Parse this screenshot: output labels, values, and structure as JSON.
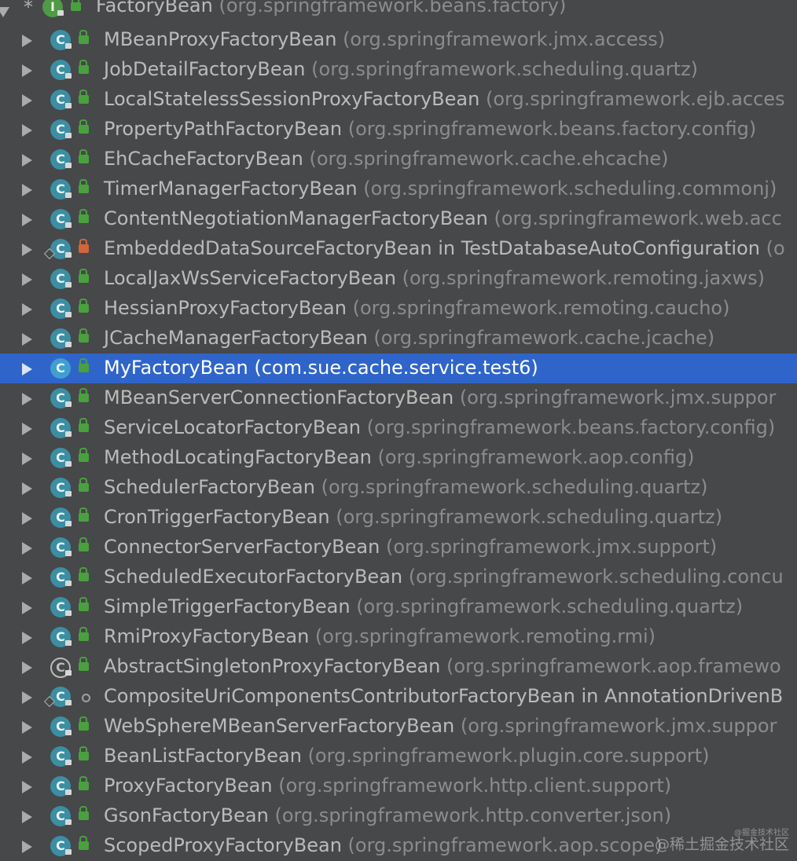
{
  "root": {
    "star": "*",
    "icon": "I",
    "name": "FactoryBean",
    "package": "(org.springframework.beans.factory)"
  },
  "items": [
    {
      "name": "MBeanProxyFactoryBean",
      "package": "(org.springframework.jmx.access)"
    },
    {
      "name": "JobDetailFactoryBean",
      "package": "(org.springframework.scheduling.quartz)"
    },
    {
      "name": "LocalStatelessSessionProxyFactoryBean",
      "package": "(org.springframework.ejb.acces"
    },
    {
      "name": "PropertyPathFactoryBean",
      "package": "(org.springframework.beans.factory.config)"
    },
    {
      "name": "EhCacheFactoryBean",
      "package": "(org.springframework.cache.ehcache)"
    },
    {
      "name": "TimerManagerFactoryBean",
      "package": "(org.springframework.scheduling.commonj)"
    },
    {
      "name": "ContentNegotiationManagerFactoryBean",
      "package": "(org.springframework.web.acc"
    },
    {
      "name": "EmbeddedDataSourceFactoryBean in TestDatabaseAutoConfiguration",
      "package": "(o"
    },
    {
      "name": "LocalJaxWsServiceFactoryBean",
      "package": "(org.springframework.remoting.jaxws)"
    },
    {
      "name": "HessianProxyFactoryBean",
      "package": "(org.springframework.remoting.caucho)"
    },
    {
      "name": "JCacheManagerFactoryBean",
      "package": "(org.springframework.cache.jcache)"
    },
    {
      "name": "MyFactoryBean",
      "package": "(com.sue.cache.service.test6)"
    },
    {
      "name": "MBeanServerConnectionFactoryBean",
      "package": "(org.springframework.jmx.suppor"
    },
    {
      "name": "ServiceLocatorFactoryBean",
      "package": "(org.springframework.beans.factory.config)"
    },
    {
      "name": "MethodLocatingFactoryBean",
      "package": "(org.springframework.aop.config)"
    },
    {
      "name": "SchedulerFactoryBean",
      "package": "(org.springframework.scheduling.quartz)"
    },
    {
      "name": "CronTriggerFactoryBean",
      "package": "(org.springframework.scheduling.quartz)"
    },
    {
      "name": "ConnectorServerFactoryBean",
      "package": "(org.springframework.jmx.support)"
    },
    {
      "name": "ScheduledExecutorFactoryBean",
      "package": "(org.springframework.scheduling.concu"
    },
    {
      "name": "SimpleTriggerFactoryBean",
      "package": "(org.springframework.scheduling.quartz)"
    },
    {
      "name": "RmiProxyFactoryBean",
      "package": "(org.springframework.remoting.rmi)"
    },
    {
      "name": "AbstractSingletonProxyFactoryBean",
      "package": "(org.springframework.aop.framewo"
    },
    {
      "name": "CompositeUriComponentsContributorFactoryBean in AnnotationDrivenB",
      "package": ""
    },
    {
      "name": "WebSphereMBeanServerFactoryBean",
      "package": "(org.springframework.jmx.suppor"
    },
    {
      "name": "BeanListFactoryBean",
      "package": "(org.springframework.plugin.core.support)"
    },
    {
      "name": "ProxyFactoryBean",
      "package": "(org.springframework.http.client.support)"
    },
    {
      "name": "GsonFactoryBean",
      "package": "(org.springframework.http.converter.json)"
    },
    {
      "name": "ScopedProxyFactoryBean",
      "package": "(org.springframework.aop.scope)"
    }
  ],
  "class_icon_letter": "C",
  "watermark": {
    "line1": "@稀土掘金技术社区",
    "line2": "@掘金技术社区"
  },
  "colors": {
    "background": "#46484a",
    "selection": "#2f65ca",
    "class_icon": "#3c8ea3",
    "interface_icon": "#4f9a44",
    "public_lock": "#4aa03f",
    "protected_lock": "#d2653a",
    "package_text": "#8a8c8e"
  }
}
